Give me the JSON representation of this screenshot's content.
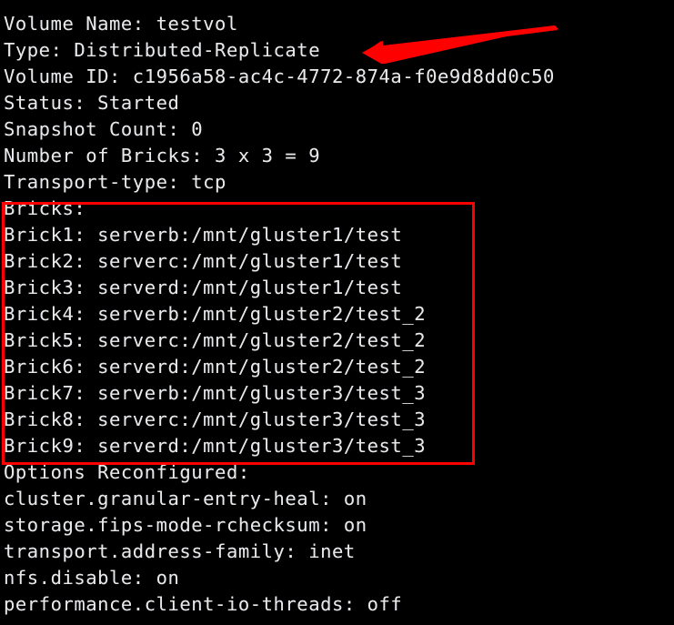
{
  "terminal": {
    "theme": {
      "background": "#000000",
      "foreground": "#e8e8e8",
      "annotation": "#fe0000"
    },
    "lines": [
      "Volume Name: testvol",
      "Type: Distributed-Replicate",
      "Volume ID: c1956a58-ac4c-4772-874a-f0e9d8dd0c50",
      "Status: Started",
      "Snapshot Count: 0",
      "Number of Bricks: 3 x 3 = 9",
      "Transport-type: tcp",
      "Bricks:",
      "Brick1: serverb:/mnt/gluster1/test",
      "Brick2: serverc:/mnt/gluster1/test",
      "Brick3: serverd:/mnt/gluster1/test",
      "Brick4: serverb:/mnt/gluster2/test_2",
      "Brick5: serverc:/mnt/gluster2/test_2",
      "Brick6: serverd:/mnt/gluster2/test_2",
      "Brick7: serverb:/mnt/gluster3/test_3",
      "Brick8: serverc:/mnt/gluster3/test_3",
      "Brick9: serverd:/mnt/gluster3/test_3",
      "Options Reconfigured:",
      "cluster.granular-entry-heal: on",
      "storage.fips-mode-rchecksum: on",
      "transport.address-family: inet",
      "nfs.disable: on",
      "performance.client-io-threads: off"
    ]
  },
  "volume_info": {
    "volume_name": "testvol",
    "type": "Distributed-Replicate",
    "volume_id": "c1956a58-ac4c-4772-874a-f0e9d8dd0c50",
    "status": "Started",
    "snapshot_count": "0",
    "number_of_bricks": "3 x 3 = 9",
    "transport_type": "tcp",
    "bricks": [
      {
        "label": "Brick1",
        "path": "serverb:/mnt/gluster1/test"
      },
      {
        "label": "Brick2",
        "path": "serverc:/mnt/gluster1/test"
      },
      {
        "label": "Brick3",
        "path": "serverd:/mnt/gluster1/test"
      },
      {
        "label": "Brick4",
        "path": "serverb:/mnt/gluster2/test_2"
      },
      {
        "label": "Brick5",
        "path": "serverc:/mnt/gluster2/test_2"
      },
      {
        "label": "Brick6",
        "path": "serverd:/mnt/gluster2/test_2"
      },
      {
        "label": "Brick7",
        "path": "serverb:/mnt/gluster3/test_3"
      },
      {
        "label": "Brick8",
        "path": "serverc:/mnt/gluster3/test_3"
      },
      {
        "label": "Brick9",
        "path": "serverd:/mnt/gluster3/test_3"
      }
    ],
    "options_reconfigured": [
      {
        "key": "cluster.granular-entry-heal",
        "value": "on"
      },
      {
        "key": "storage.fips-mode-rchecksum",
        "value": "on"
      },
      {
        "key": "transport.address-family",
        "value": "inet"
      },
      {
        "key": "nfs.disable",
        "value": "on"
      },
      {
        "key": "performance.client-io-threads",
        "value": "off"
      }
    ]
  },
  "annotations": {
    "arrow": {
      "target_text": "Distributed-Replicate",
      "color": "#fe0000"
    },
    "box": {
      "target_section": "Bricks",
      "color": "#fe0000"
    }
  }
}
